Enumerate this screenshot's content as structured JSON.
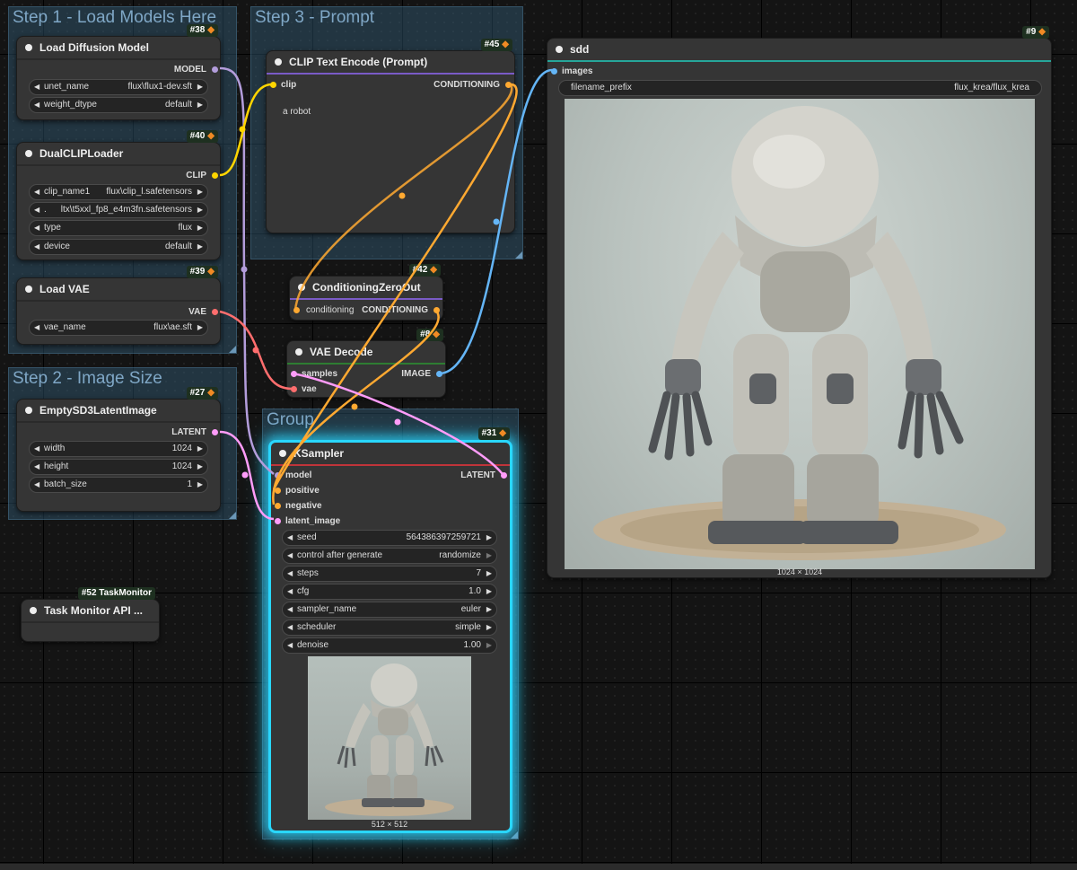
{
  "groups": {
    "step1": "Step 1 - Load Models Here",
    "step2": "Step 2 - Image Size",
    "step3": "Step 3 - Prompt",
    "group": "Group"
  },
  "nodes": {
    "load_diffusion": {
      "id": "#38",
      "title": "Load Diffusion Model",
      "output": "MODEL",
      "widgets": [
        {
          "label": "unet_name",
          "value": "flux\\flux1-dev.sft"
        },
        {
          "label": "weight_dtype",
          "value": "default"
        }
      ]
    },
    "dual_clip": {
      "id": "#40",
      "title": "DualCLIPLoader",
      "output": "CLIP",
      "widgets": [
        {
          "label": "clip_name1",
          "value": "flux\\clip_l.safetensors"
        },
        {
          "label": ".",
          "value": "ltx\\t5xxl_fp8_e4m3fn.safetensors"
        },
        {
          "label": "type",
          "value": "flux"
        },
        {
          "label": "device",
          "value": "default"
        }
      ]
    },
    "load_vae": {
      "id": "#39",
      "title": "Load VAE",
      "output": "VAE",
      "widgets": [
        {
          "label": "vae_name",
          "value": "flux\\ae.sft"
        }
      ]
    },
    "empty_latent": {
      "id": "#27",
      "title": "EmptySD3LatentImage",
      "output": "LATENT",
      "widgets": [
        {
          "label": "width",
          "value": "1024"
        },
        {
          "label": "height",
          "value": "1024"
        },
        {
          "label": "batch_size",
          "value": "1"
        }
      ]
    },
    "clip_text": {
      "id": "#45",
      "title": "CLIP Text Encode (Prompt)",
      "input": "clip",
      "output": "CONDITIONING",
      "prompt": "a robot"
    },
    "cond_zero": {
      "id": "#42",
      "title": "ConditioningZeroOut",
      "input": "conditioning",
      "output": "CONDITIONING"
    },
    "vae_decode": {
      "id": "#8",
      "title": "VAE Decode",
      "inputs": [
        "samples",
        "vae"
      ],
      "output": "IMAGE"
    },
    "ksampler": {
      "id": "#31",
      "title": "KSampler",
      "inputs": [
        "model",
        "positive",
        "negative",
        "latent_image"
      ],
      "output": "LATENT",
      "widgets": [
        {
          "label": "seed",
          "value": "564386397259721"
        },
        {
          "label": "control after generate",
          "value": "randomize"
        },
        {
          "label": "steps",
          "value": "7"
        },
        {
          "label": "cfg",
          "value": "1.0"
        },
        {
          "label": "sampler_name",
          "value": "euler"
        },
        {
          "label": "scheduler",
          "value": "simple"
        },
        {
          "label": "denoise",
          "value": "1.00"
        }
      ],
      "preview_caption": "512 × 512"
    },
    "save": {
      "id": "#9",
      "title": "sdd",
      "input": "images",
      "filename_label": "filename_prefix",
      "filename_value": "flux_krea/flux_krea",
      "preview_caption": "1024 × 1024"
    },
    "task_monitor": {
      "id": "#52 TaskMonitor",
      "title": "Task Monitor API ..."
    }
  },
  "colors": {
    "model": "#b39ddb",
    "clip": "#ffd500",
    "vae": "#ff6e6e",
    "conditioning": "#ffa931",
    "latent": "#ff9cf9",
    "image": "#64b5f6",
    "ksampler_glow": "#29d7ff"
  }
}
